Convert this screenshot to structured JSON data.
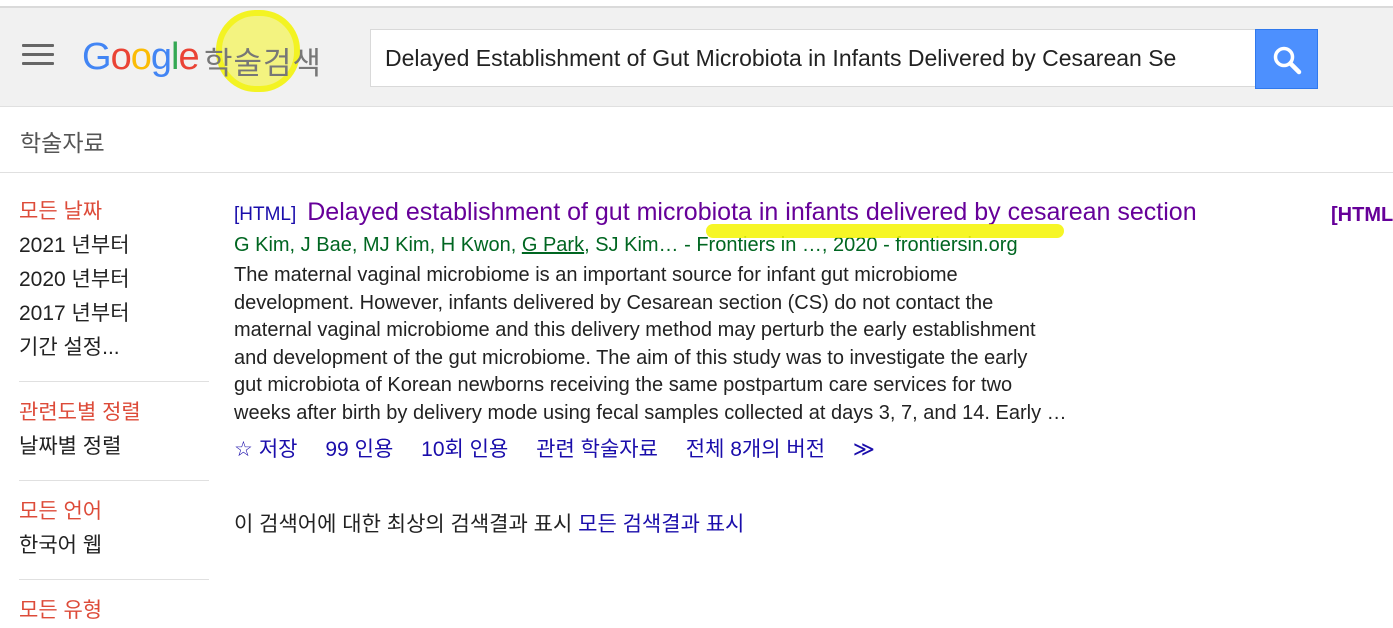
{
  "header": {
    "logo_letters": [
      "G",
      "o",
      "o",
      "g",
      "l",
      "e"
    ],
    "logo_sub": "학술검색",
    "search_value": "Delayed Establishment of Gut Microbiota in Infants Delivered by Cesarean Se"
  },
  "section_label": "학술자료",
  "sidebar": {
    "date_group": [
      "모든 날짜",
      "2021 년부터",
      "2020 년부터",
      "2017 년부터",
      "기간 설정..."
    ],
    "sort_group": [
      "관련도별 정렬",
      "날짜별 정렬"
    ],
    "lang_group": [
      "모든 언어",
      "한국어 웹"
    ],
    "type_group_partial": "모든 유형"
  },
  "result": {
    "tag": "[HTML]",
    "title": "Delayed establishment of gut microbiota in infants delivered by cesarean section",
    "authors_before": "G Kim, J Bae, MJ Kim, H Kwon, ",
    "author_link": "G Park",
    "authors_after": ", SJ Kim… - Frontiers in …, 2020 - frontiersin.org",
    "abstract": [
      "The maternal vaginal microbiome is an important source for infant gut microbiome",
      "development. However, infants delivered by Cesarean section (CS) do not contact the",
      "maternal vaginal microbiome and this delivery method may perturb the early establishment",
      "and development of the gut microbiome. The aim of this study was to investigate the early",
      "gut microbiota of Korean newborns receiving the same postpartum care services for two",
      "weeks after birth by delivery mode using fecal samples collected at days 3, 7, and 14. Early …"
    ],
    "actions": {
      "save": "저장",
      "cite": "인용",
      "cited_by": "10회 인용",
      "related": "관련 학술자료",
      "versions": "전체 8개의 버전",
      "more": "≫"
    },
    "right_tag": "[HTML"
  },
  "more_results": {
    "text": "이 검색어에 대한 최상의 검색결과 표시 ",
    "link": "모든 검색결과 표시"
  },
  "colors": {
    "title_purple": "#660099",
    "link_blue": "#1a0dab",
    "meta_green": "#006621",
    "sidebar_red": "#dd4b39",
    "search_button": "#4d90fe",
    "highlight_yellow": "#f4f400"
  }
}
